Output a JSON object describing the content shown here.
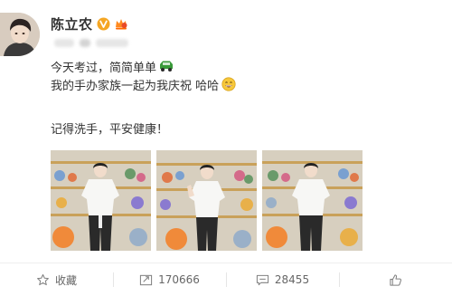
{
  "author": {
    "name": "陈立农",
    "verified_icon": "v-badge-icon",
    "member_icon": "vip-crown-icon"
  },
  "post": {
    "lines": [
      {
        "text": "今天考过，简简单单",
        "emoji": "car-emoji"
      },
      {
        "text": "我的手办家族一起为我庆祝 哈哈",
        "emoji": "grin-emoji"
      },
      {
        "text": "记得洗手，平安健康！"
      }
    ],
    "images": [
      {
        "icon": "photo-1"
      },
      {
        "icon": "photo-2"
      },
      {
        "icon": "photo-3"
      }
    ]
  },
  "actions": {
    "favorite": {
      "label": "收藏",
      "icon": "star-icon"
    },
    "repost": {
      "count": "170666",
      "icon": "repost-icon"
    },
    "comment": {
      "count": "28455",
      "icon": "comment-icon"
    },
    "like": {
      "icon": "thumbs-up-icon"
    }
  },
  "colors": {
    "text": "#333333",
    "muted": "#666666",
    "verified": "#f5a623",
    "car_emoji": "#3a9a3a",
    "grin_emoji": "#f7c83a"
  }
}
